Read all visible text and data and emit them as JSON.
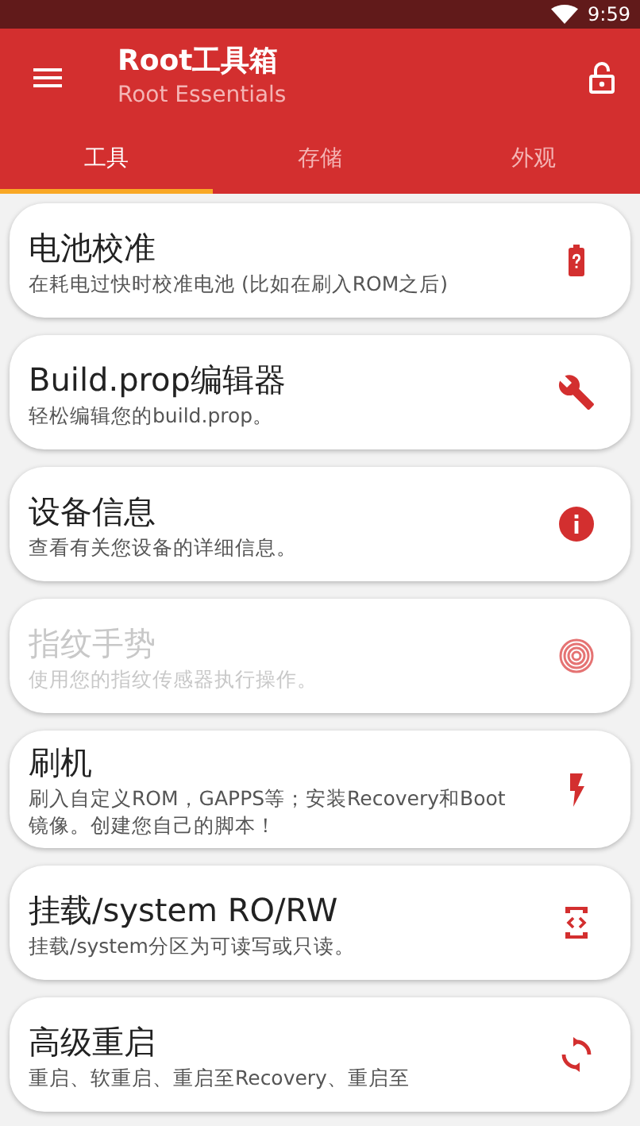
{
  "status_bar": {
    "time": "9:59"
  },
  "toolbar": {
    "title": "Root工具箱",
    "subtitle": "Root Essentials"
  },
  "tabs": [
    {
      "label": "工具",
      "selected": true
    },
    {
      "label": "存储",
      "selected": false
    },
    {
      "label": "外观",
      "selected": false
    }
  ],
  "cards": [
    {
      "title": "电池校准",
      "subtitle": "在耗电过快时校准电池 (比如在刷入ROM之后)",
      "disabled": false
    },
    {
      "title": "Build.prop编辑器",
      "subtitle": "轻松编辑您的build.prop。",
      "disabled": false
    },
    {
      "title": "设备信息",
      "subtitle": "查看有关您设备的详细信息。",
      "disabled": false
    },
    {
      "title": "指纹手势",
      "subtitle": "使用您的指纹传感器执行操作。",
      "disabled": true
    },
    {
      "title": "刷机",
      "subtitle": "刷入自定义ROM，GAPPS等；安装Recovery和Boot镜像。创建您自己的脚本！",
      "disabled": false
    },
    {
      "title": "挂载/system RO/RW",
      "subtitle": "挂载/system分区为可读写或只读。",
      "disabled": false
    },
    {
      "title": "高级重启",
      "subtitle": "重启、软重启、重启至Recovery、重启至",
      "disabled": false
    }
  ]
}
